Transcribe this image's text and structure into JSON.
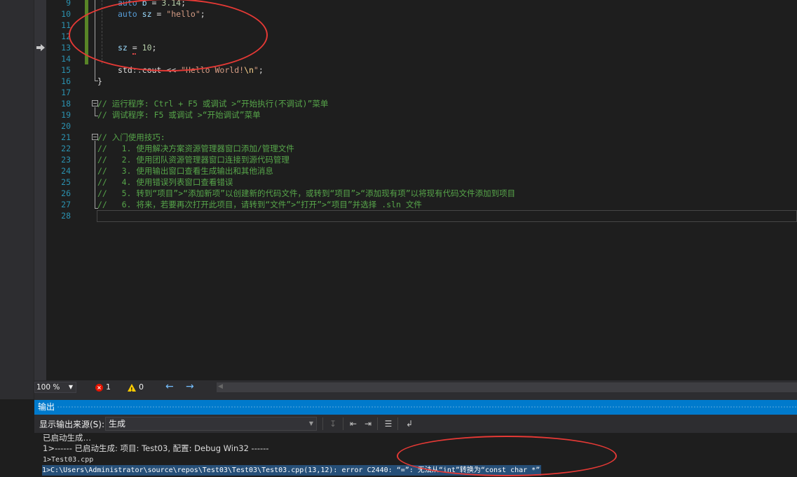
{
  "editor": {
    "lines": [
      {
        "num": "9"
      },
      {
        "num": "10"
      },
      {
        "num": "11"
      },
      {
        "num": "12"
      },
      {
        "num": "13"
      },
      {
        "num": "14"
      },
      {
        "num": "15"
      },
      {
        "num": "16"
      },
      {
        "num": "17"
      },
      {
        "num": "18"
      },
      {
        "num": "19"
      },
      {
        "num": "20"
      },
      {
        "num": "21"
      },
      {
        "num": "22"
      },
      {
        "num": "23"
      },
      {
        "num": "24"
      },
      {
        "num": "25"
      },
      {
        "num": "26"
      },
      {
        "num": "27"
      },
      {
        "num": "28"
      }
    ],
    "code": {
      "l9_kw": "auto",
      "l9_id": "b",
      "l9_op": " = ",
      "l9_num": "3.14",
      "l9_end": ";",
      "l10_kw": "auto",
      "l10_id": "sz",
      "l10_op": " = ",
      "l10_str": "\"hello\"",
      "l10_end": ";",
      "l13_id": "sz",
      "l13_op": " = ",
      "l13_num": "10",
      "l13_end": ";",
      "l15_ns": "std",
      "l15_sep": "::",
      "l15_id": "cout",
      "l15_op": " << ",
      "l15_str": "\"Hello World!",
      "l15_esc": "\\n",
      "l15_str2": "\"",
      "l15_end": ";",
      "l16": "}",
      "l18": "// 运行程序: Ctrl + F5 或调试 >“开始执行(不调试)”菜单",
      "l19": "// 调试程序: F5 或调试 >“开始调试”菜单",
      "l21": "// 入门使用技巧:",
      "l22": "//   1. 使用解决方案资源管理器窗口添加/管理文件",
      "l23": "//   2. 使用团队资源管理器窗口连接到源代码管理",
      "l24": "//   3. 使用输出窗口查看生成输出和其他消息",
      "l25": "//   4. 使用错误列表窗口查看错误",
      "l26": "//   5. 转到“项目”>“添加新项”以创建新的代码文件，或转到“项目”>“添加现有项”以将现有代码文件添加到项目",
      "l27": "//   6. 将来，若要再次打开此项目，请转到“文件”>“打开”>“项目”并选择 .sln 文件"
    }
  },
  "status": {
    "zoom": "100 %",
    "errors": "1",
    "warnings": "0"
  },
  "output": {
    "title": "输出",
    "source_label": "显示输出来源(S):",
    "source_value": "生成",
    "lines": [
      "已启动生成…",
      "1>------ 已启动生成: 项目: Test03, 配置: Debug Win32 ------",
      "1>Test03.cpp",
      "1>C:\\Users\\Administrator\\source\\repos\\Test03\\Test03\\Test03.cpp(13,12): error C2440: “=”: 无法从“int”转换为“const char *”"
    ]
  },
  "colors": {
    "accent": "#007acc",
    "annotation_red": "#e53935",
    "editor_bg": "#1e1e1e",
    "line_number": "#2b91af",
    "comment": "#57a64a"
  }
}
